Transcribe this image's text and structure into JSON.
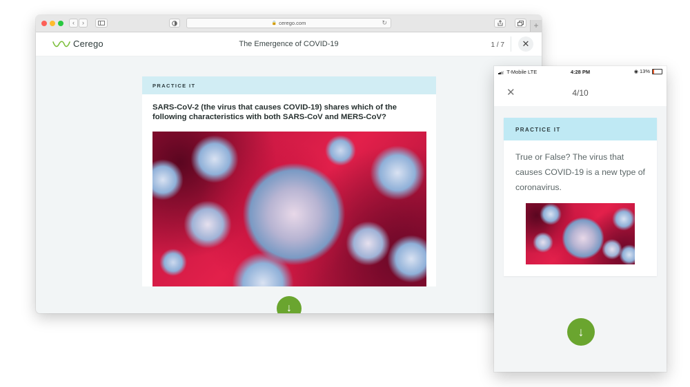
{
  "browser": {
    "url": "cerego.com",
    "controls": {
      "back": "‹",
      "forward": "›",
      "reload": "↻",
      "new_tab": "+"
    }
  },
  "app": {
    "logo_text": "Cerego",
    "title": "The Emergence of COVID-19",
    "progress": "1 / 7",
    "close_icon": "✕"
  },
  "desktop_card": {
    "label": "PRACTICE IT",
    "question": "SARS-CoV-2 (the virus that causes COVID-19) shares which of the following characteristics with both SARS-CoV and MERS-CoV?",
    "next_icon": "↓"
  },
  "phone": {
    "status": {
      "carrier": "T-Mobile",
      "network": "LTE",
      "time": "4:28 PM",
      "battery": "13%"
    },
    "close_icon": "✕",
    "progress": "4/10",
    "card": {
      "label": "PRACTICE IT",
      "question": "True or False? The virus that causes COVID-19 is a new type of coronavirus."
    },
    "next_icon": "↓"
  },
  "colors": {
    "accent_green": "#6aa52f",
    "band_blue": "#d1edf4",
    "logo_green": "#7bbf3a"
  }
}
